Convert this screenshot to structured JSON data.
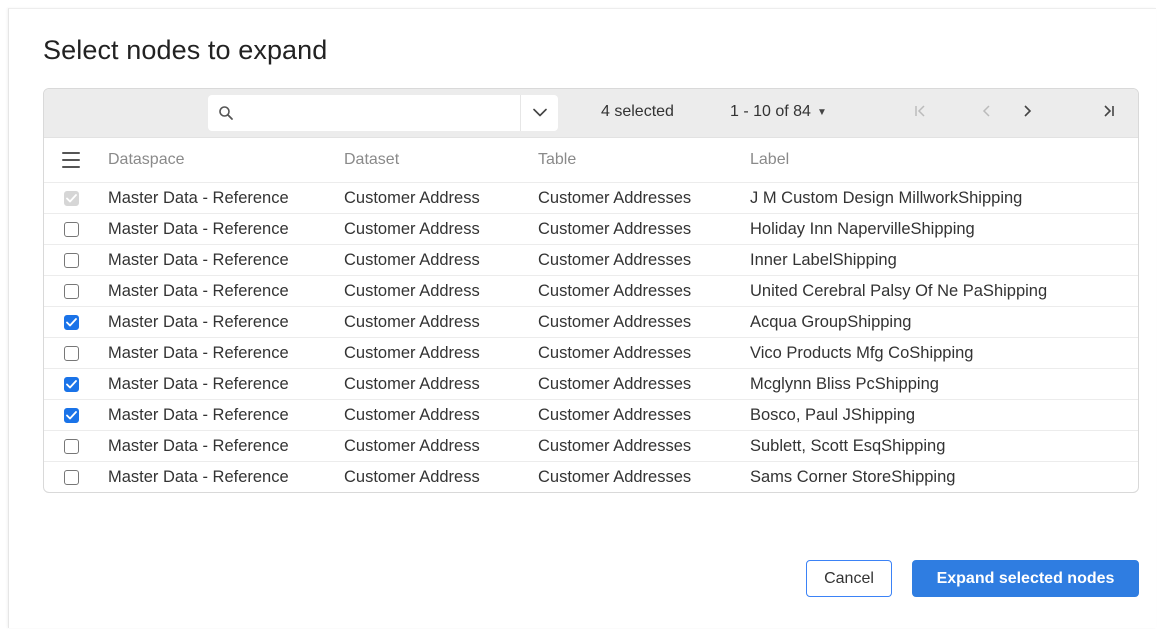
{
  "dialog": {
    "title": "Select nodes to expand",
    "cancel_label": "Cancel",
    "confirm_label": "Expand selected nodes"
  },
  "toolbar": {
    "search_value": "",
    "search_placeholder": "",
    "selected_text": "4 selected",
    "range_text": "1 - 10 of 84"
  },
  "columns": {
    "dataspace": "Dataspace",
    "dataset": "Dataset",
    "table": "Table",
    "label": "Label"
  },
  "rows": [
    {
      "state": "disabled",
      "dataspace": "Master Data - Reference",
      "dataset": "Customer Address",
      "table": "Customer Addresses",
      "label": "J M Custom Design MillworkShipping"
    },
    {
      "state": "unchecked",
      "dataspace": "Master Data - Reference",
      "dataset": "Customer Address",
      "table": "Customer Addresses",
      "label": "Holiday Inn NapervilleShipping"
    },
    {
      "state": "unchecked",
      "dataspace": "Master Data - Reference",
      "dataset": "Customer Address",
      "table": "Customer Addresses",
      "label": "Inner LabelShipping"
    },
    {
      "state": "unchecked",
      "dataspace": "Master Data - Reference",
      "dataset": "Customer Address",
      "table": "Customer Addresses",
      "label": "United Cerebral Palsy Of Ne PaShipping"
    },
    {
      "state": "checked",
      "dataspace": "Master Data - Reference",
      "dataset": "Customer Address",
      "table": "Customer Addresses",
      "label": "Acqua GroupShipping"
    },
    {
      "state": "unchecked",
      "dataspace": "Master Data - Reference",
      "dataset": "Customer Address",
      "table": "Customer Addresses",
      "label": "Vico Products Mfg CoShipping"
    },
    {
      "state": "checked",
      "dataspace": "Master Data - Reference",
      "dataset": "Customer Address",
      "table": "Customer Addresses",
      "label": "Mcglynn Bliss PcShipping"
    },
    {
      "state": "checked",
      "dataspace": "Master Data - Reference",
      "dataset": "Customer Address",
      "table": "Customer Addresses",
      "label": "Bosco, Paul JShipping"
    },
    {
      "state": "unchecked",
      "dataspace": "Master Data - Reference",
      "dataset": "Customer Address",
      "table": "Customer Addresses",
      "label": "Sublett, Scott EsqShipping"
    },
    {
      "state": "unchecked",
      "dataspace": "Master Data - Reference",
      "dataset": "Customer Address",
      "table": "Customer Addresses",
      "label": "Sams Corner StoreShipping"
    }
  ],
  "colors": {
    "accent": "#2f7de1",
    "checkbox_checked": "#1a73e8",
    "checkbox_disabled": "#d6d6d6",
    "toolbar_bg": "#ececec"
  }
}
